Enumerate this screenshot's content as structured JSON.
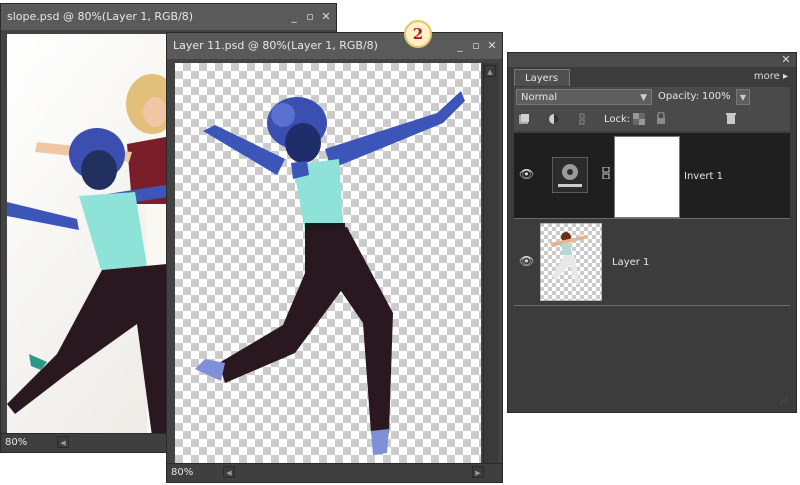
{
  "back_window": {
    "title": "slope.psd @ 80%(Layer 1, RGB/8)",
    "zoom": "80%"
  },
  "front_window": {
    "title": "Layer 11.psd @ 80%(Layer 1, RGB/8)",
    "zoom": "80%"
  },
  "badge": "2",
  "window_controls": {
    "minimize": "_",
    "maximize": "▫",
    "close": "✕"
  },
  "layers_panel": {
    "tab": "Layers",
    "more": "more ▸",
    "blend_mode": "Normal",
    "opacity_label": "Opacity:",
    "opacity_value": "100%",
    "lock_label": "Lock:",
    "layers": [
      {
        "name": "Invert 1",
        "visible": true,
        "selected": true
      },
      {
        "name": "Layer 1",
        "visible": true,
        "selected": false
      }
    ]
  },
  "colors": {
    "panel_bg": "#3c3c3c",
    "selected_layer": "#1f1f1f",
    "badge_text": "#b8161a",
    "figure_blue": "#3b55b8"
  }
}
